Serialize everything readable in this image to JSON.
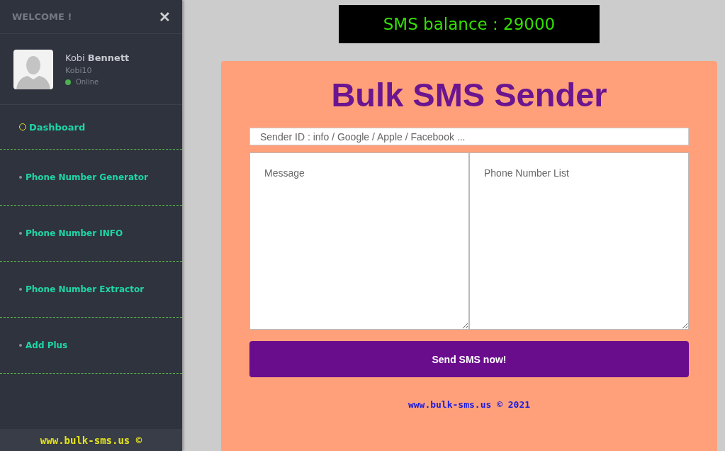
{
  "sidebar": {
    "header": "WELCOME !",
    "close": "✕",
    "user": {
      "first_name": "Kobi",
      "last_name": "Bennett",
      "username": "Kobi10",
      "status": "Online"
    },
    "items": [
      {
        "label": "Dashboard",
        "selected": true
      },
      {
        "label": "Phone Number Generator",
        "selected": false
      },
      {
        "label": "Phone Number INFO",
        "selected": false
      },
      {
        "label": "Phone Number Extractor",
        "selected": false
      },
      {
        "label": "Add Plus",
        "selected": false
      }
    ],
    "footer": "www.bulk-sms.us ©"
  },
  "balance": "SMS balance : 29000",
  "form": {
    "title": "Bulk SMS Sender",
    "sender": {
      "placeholder": "Sender ID : info / Google / Apple / Facebook ..."
    },
    "message": {
      "placeholder": "Message"
    },
    "numbers": {
      "placeholder": "Phone Number List"
    },
    "button": "Send SMS now!",
    "footer": "www.bulk-sms.us © 2021"
  }
}
